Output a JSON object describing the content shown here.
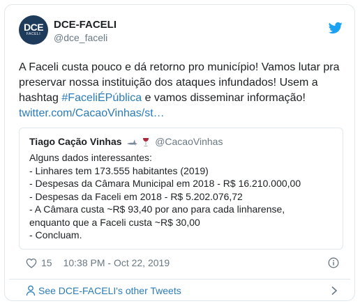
{
  "author": {
    "avatar_line1": "DCE",
    "avatar_line2": "FACELI",
    "display_name": "DCE-FACELI",
    "handle": "@dce_faceli"
  },
  "tweet": {
    "text_part1": "A Faceli custa pouco e dá retorno pro município! Vamos lutar pra preservar nossa instituição dos ataques infundados! Usem a hashtag ",
    "hashtag": "#FaceliÉPública",
    "text_part2": " e vamos disseminar informação!",
    "link": "twitter.com/CacaoVinhas/st…"
  },
  "quoted": {
    "name": "Tiago Cação Vinhas",
    "handle": "@CacaoVinhas",
    "lines": [
      "Alguns dados interessantes:",
      "- Linhares tem 173.555 habitantes (2019)",
      "- Despesas da Câmara Municipal em 2018 - R$ 16.210.000,00",
      "- Despesas da Faceli em 2018 - R$ 5.202.076,72",
      "- A Câmara custa ~R$ 93,40 por ano para cada linharense,",
      "enquanto que a Faceli custa ~R$ 30,00",
      "- Concluam."
    ]
  },
  "meta": {
    "likes": "15",
    "timestamp": "10:38 PM - Oct 22, 2019"
  },
  "footer": {
    "label": "See DCE-FACELI's other Tweets"
  },
  "colors": {
    "link": "#2b7bb9",
    "muted": "#697882",
    "twitter_blue": "#1da1f2",
    "border": "#e1e8ed"
  },
  "icons": [
    "twitter-bird-icon",
    "heart-icon",
    "info-icon",
    "person-icon",
    "chevron-right-icon",
    "shark-icon",
    "wine-glass-icon"
  ]
}
